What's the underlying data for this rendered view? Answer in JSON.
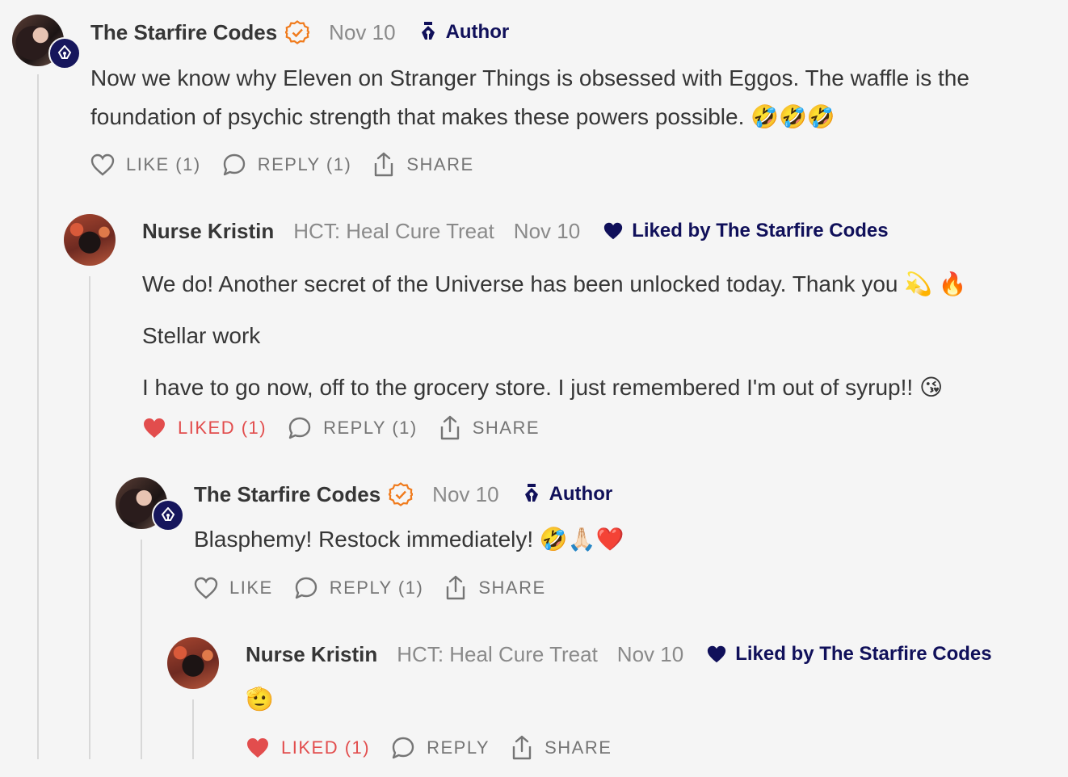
{
  "comments": [
    {
      "author": "The Starfire Codes",
      "date": "Nov 10",
      "role": "Author",
      "body": [
        "Now we know why Eleven on Stranger Things is obsessed with Eggos. The waffle is the",
        "foundation of psychic strength that makes these powers possible. 🤣🤣🤣"
      ],
      "like_label": "LIKE (1)",
      "reply_label": "REPLY (1)",
      "share_label": "SHARE"
    },
    {
      "author": "Nurse Kristin",
      "publication": "HCT: Heal Cure Treat",
      "date": "Nov 10",
      "liked_by": "Liked by The Starfire Codes",
      "body": [
        "We do! Another secret of the Universe has been unlocked today. Thank you 💫 🔥",
        "Stellar work",
        "I have to go now, off to the grocery store. I just remembered I'm out of syrup!! 😘"
      ],
      "like_label": "LIKED (1)",
      "reply_label": "REPLY (1)",
      "share_label": "SHARE"
    },
    {
      "author": "The Starfire Codes",
      "date": "Nov 10",
      "role": "Author",
      "body": [
        "Blasphemy! Restock immediately! 🤣🙏🏻❤️"
      ],
      "like_label": "LIKE",
      "reply_label": "REPLY (1)",
      "share_label": "SHARE"
    },
    {
      "author": "Nurse Kristin",
      "publication": "HCT: Heal Cure Treat",
      "date": "Nov 10",
      "liked_by": "Liked by The Starfire Codes",
      "body": [
        "🫡"
      ],
      "like_label": "LIKED (1)",
      "reply_label": "REPLY",
      "share_label": "SHARE"
    }
  ],
  "colors": {
    "author_badge": "#16165c",
    "liked": "#e24d4d",
    "verified": "#f07b1d",
    "role_text": "#10105a"
  },
  "icons": [
    "author-pen-icon",
    "verified-check-icon",
    "heart-icon",
    "comment-bubble-icon",
    "share-upload-icon"
  ]
}
